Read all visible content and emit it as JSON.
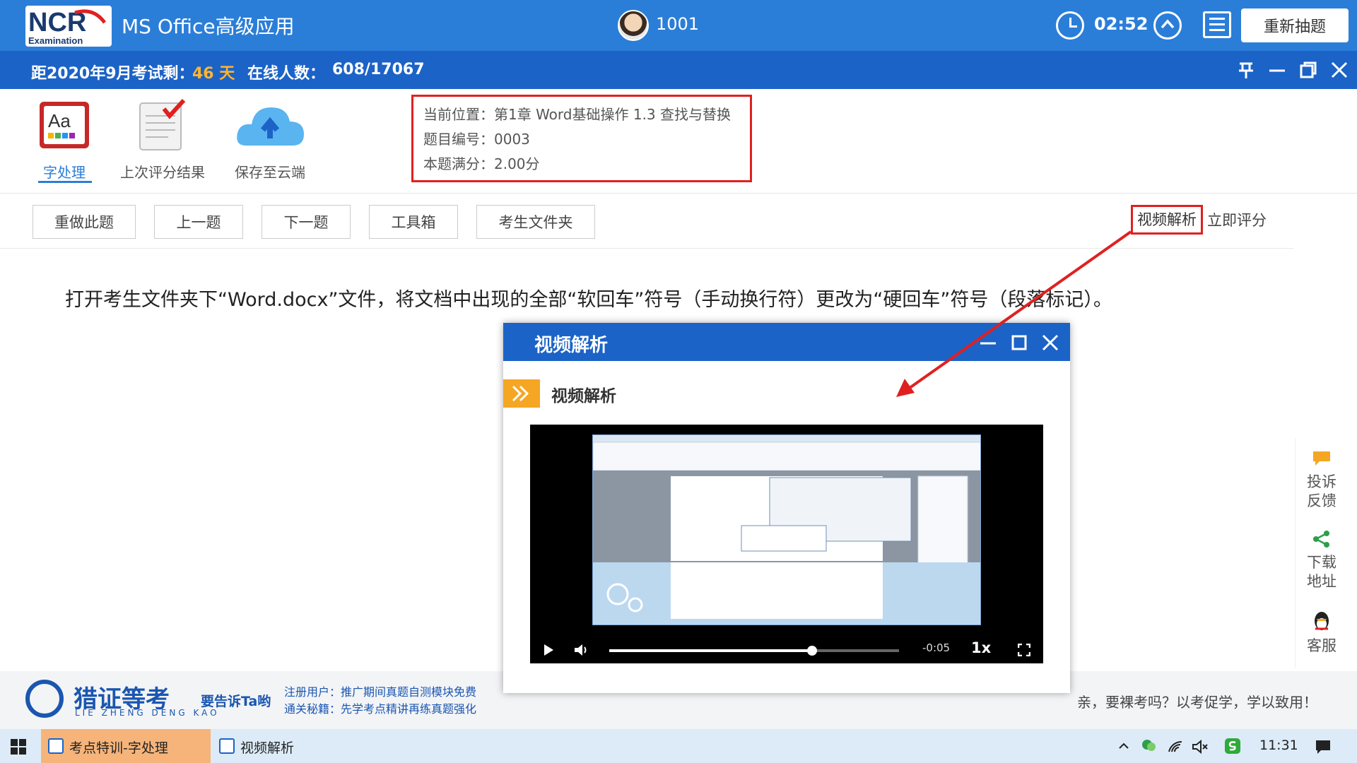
{
  "header": {
    "logo_text": "NCR",
    "logo_sub": "Examination",
    "app_title": "MS Office高级应用",
    "user_id": "1001",
    "timer": "02:52",
    "redraw_label": "重新抽题"
  },
  "infobar": {
    "countdown_label": "距2020年9月考试剩：",
    "countdown_value": "46 天",
    "online_label": "在线人数：",
    "online_value": "608/17067"
  },
  "tools": [
    {
      "label": "字处理",
      "icon": "word-processing-icon"
    },
    {
      "label": "上次评分结果",
      "icon": "score-result-icon"
    },
    {
      "label": "保存至云端",
      "icon": "cloud-upload-icon"
    }
  ],
  "question_info": {
    "position": "当前位置：第1章 Word基础操作 1.3 查找与替换",
    "number": "题目编号：0003",
    "score": "本题满分：2.00分"
  },
  "actions": [
    "重做此题",
    "上一题",
    "下一题",
    "工具箱",
    "考生文件夹"
  ],
  "links": {
    "video": "视频解析",
    "score_now": "立即评分"
  },
  "question_text": "打开考生文件夹下“Word.docx”文件，将文档中出现的全部“软回车”符号（手动换行符）更改为“硬回车”符号（段落标记）。",
  "right_panel": {
    "feedback": [
      "投诉",
      "反馈"
    ],
    "download": [
      "下载",
      "地址"
    ],
    "service": "客服"
  },
  "footer": {
    "brand": "猎证等考",
    "brand_sub": "LIE ZHENG DENG KAO",
    "tell": "要告诉Ta哟",
    "line1": "注册用户：推广期间真题自测模块免费",
    "line2": "通关秘籍：先学考点精讲再练真题强化",
    "slogan": "亲，要裸考吗？以考促学，学以致用！"
  },
  "dialog": {
    "title": "视频解析",
    "section": "视频解析",
    "video": {
      "time": "-0:05",
      "speed": "1x",
      "progress": 0.7
    }
  },
  "taskbar": {
    "tasks": [
      "考点特训-字处理",
      "视频解析"
    ],
    "clock": "11:31"
  },
  "colors": {
    "titlebar": "#2b7ed8",
    "infobar": "#1c63c7",
    "highlight_border": "#e02020",
    "countdown": "#ffb52e",
    "section_accent": "#f5a623"
  }
}
